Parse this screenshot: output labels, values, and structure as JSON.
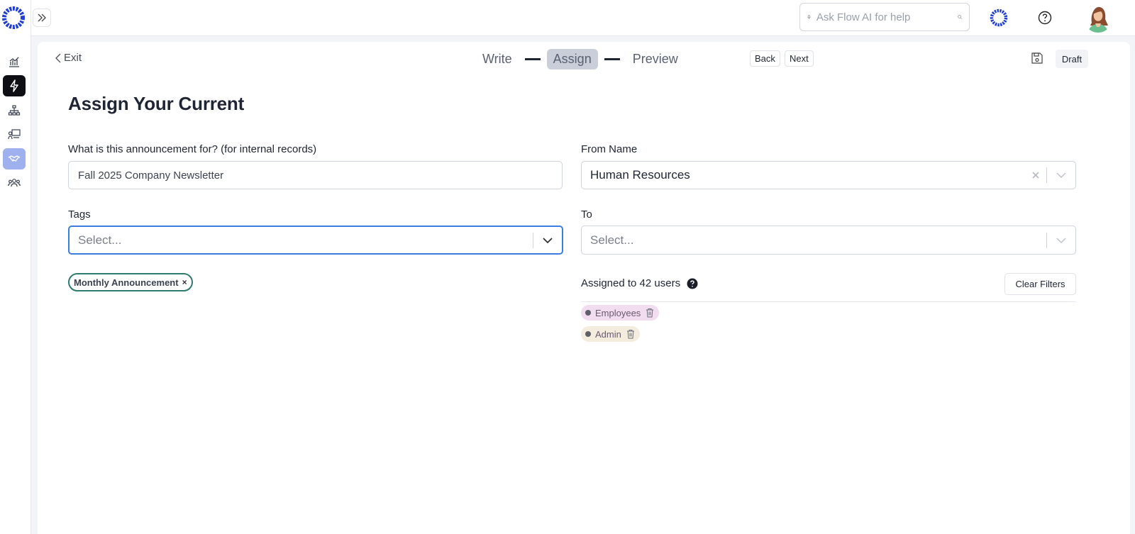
{
  "search": {
    "placeholder": "Ask Flow AI for help"
  },
  "header": {
    "exit_label": "Exit",
    "steps": [
      "Write",
      "Assign",
      "Preview"
    ],
    "active_step": "Assign",
    "back_label": "Back",
    "next_label": "Next",
    "draft_label": "Draft"
  },
  "page": {
    "title": "Assign Your Current"
  },
  "form": {
    "purpose": {
      "label": "What is this announcement for? (for internal records)",
      "value": "Fall 2025 Company Newsletter"
    },
    "from_name": {
      "label": "From Name",
      "value": "Human Resources"
    },
    "tags": {
      "label": "Tags",
      "placeholder": "Select...",
      "selected": [
        "Monthly Announcement"
      ],
      "remove_glyph": "×"
    },
    "to": {
      "label": "To",
      "placeholder": "Select..."
    }
  },
  "assignment": {
    "summary": "Assigned to 42 users",
    "clear_filters_label": "Clear Filters",
    "groups": [
      {
        "label": "Employees",
        "color": "#f2dcf0"
      },
      {
        "label": "Admin",
        "color": "#f4ecdc"
      }
    ]
  },
  "colors": {
    "accent": "#1f3fd6",
    "focus": "#3b7de0",
    "tag_border": "#2f7a70",
    "selected_nav": "#9fb0ee"
  },
  "icons": [
    "logo-icon",
    "analytics-icon",
    "bolt-icon",
    "org-chart-icon",
    "presentation-icon",
    "handshake-icon",
    "users-icon",
    "expand-icon",
    "mic-icon",
    "search-icon",
    "help-icon",
    "save-icon",
    "chevron-down-icon",
    "clear-icon",
    "question-icon",
    "trash-icon"
  ]
}
